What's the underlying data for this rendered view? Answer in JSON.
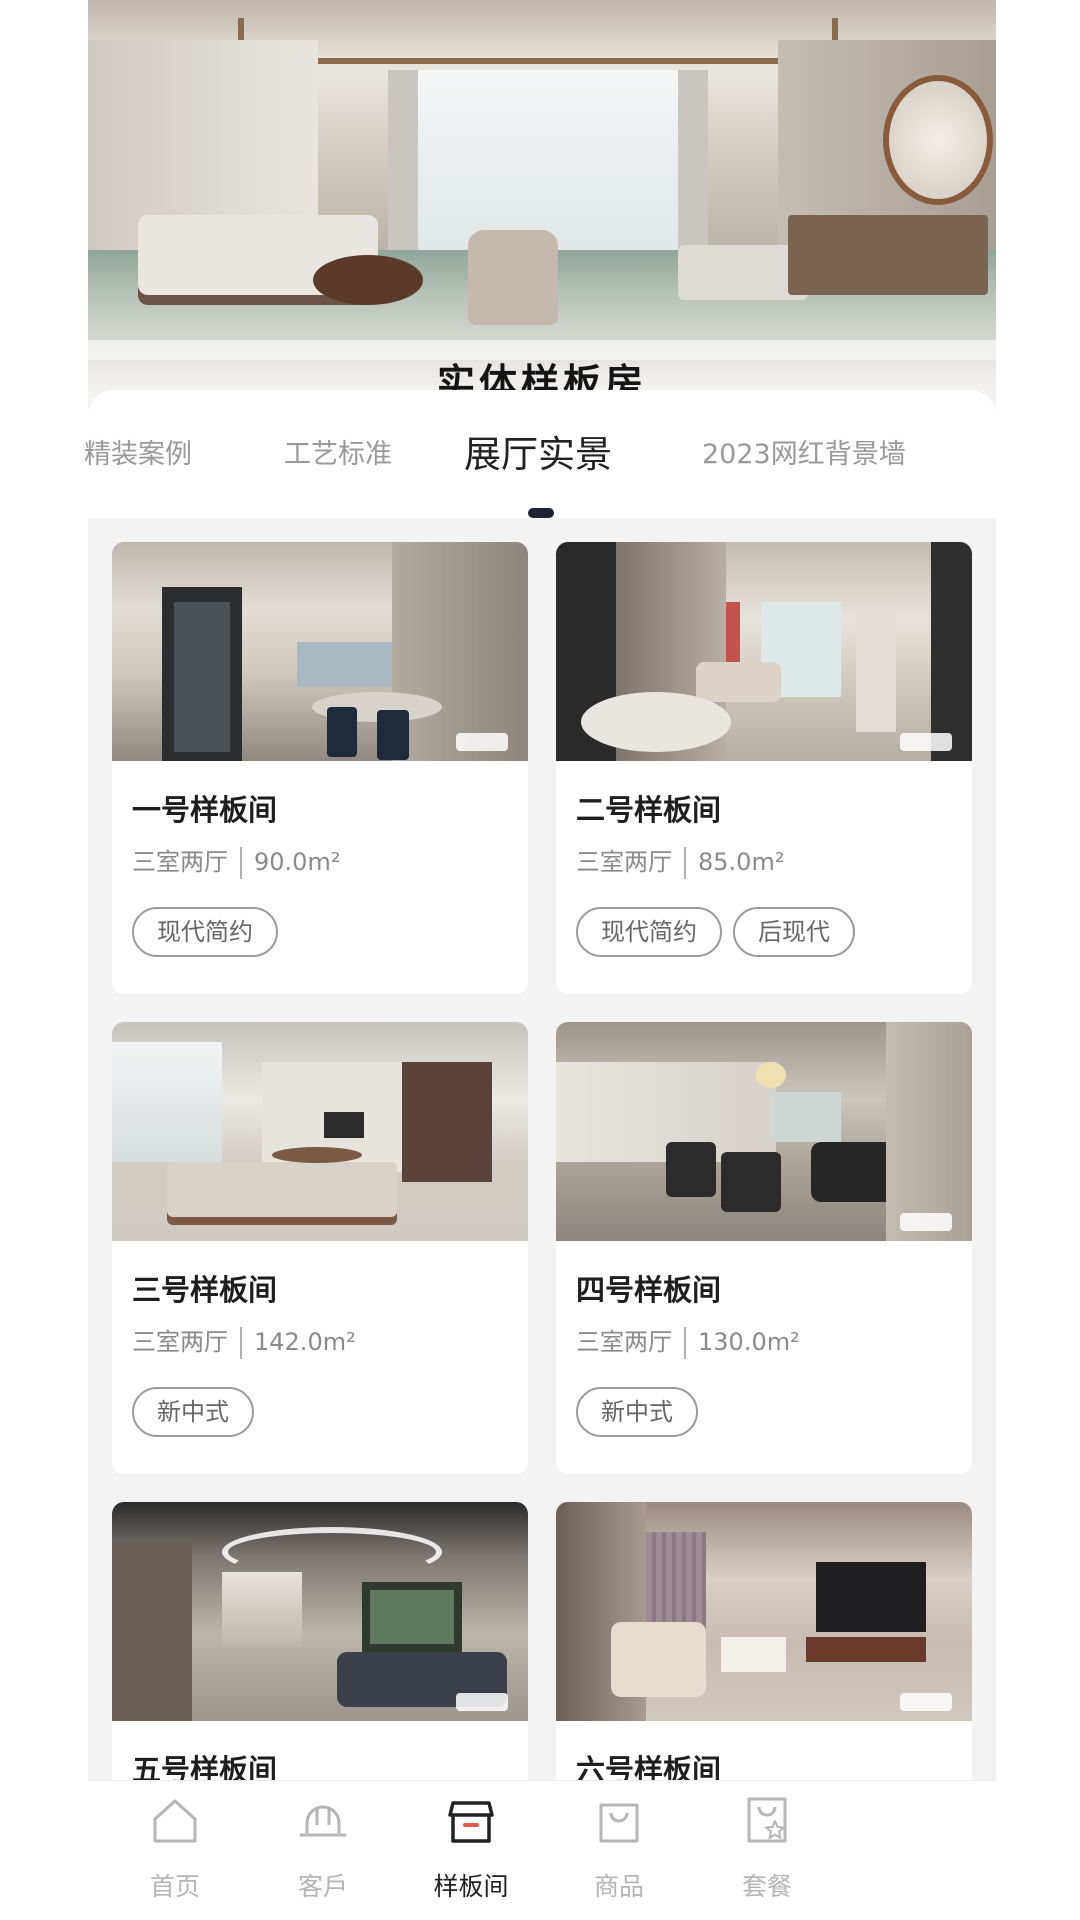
{
  "banner": {
    "caption": "实体样板房"
  },
  "tabs": [
    {
      "label": "精装案例",
      "active": false
    },
    {
      "label": "工艺标准",
      "active": false
    },
    {
      "label": "展厅实景",
      "active": true
    },
    {
      "label": "2023网红背景墙",
      "active": false
    }
  ],
  "cards": [
    {
      "name": "一号样板间",
      "layout": "三室两厅",
      "area": "90.0m²",
      "tags": [
        "现代简约"
      ]
    },
    {
      "name": "二号样板间",
      "layout": "三室两厅",
      "area": "85.0m²",
      "tags": [
        "现代简约",
        "后现代"
      ]
    },
    {
      "name": "三号样板间",
      "layout": "三室两厅",
      "area": "142.0m²",
      "tags": [
        "新中式"
      ]
    },
    {
      "name": "四号样板间",
      "layout": "三室两厅",
      "area": "130.0m²",
      "tags": [
        "新中式"
      ]
    },
    {
      "name": "五号样板间"
    },
    {
      "name": "六号样板间"
    }
  ],
  "bottom_nav": [
    {
      "label": "首页",
      "icon": "home-icon",
      "active": false
    },
    {
      "label": "客戶",
      "icon": "helmet-icon",
      "active": false
    },
    {
      "label": "样板间",
      "icon": "store-icon",
      "active": true
    },
    {
      "label": "商品",
      "icon": "shopping-bag-icon",
      "active": false
    },
    {
      "label": "套餐",
      "icon": "package-star-icon",
      "active": false
    }
  ],
  "colors": {
    "active_text": "#222222",
    "inactive_text": "#b5b5b5",
    "indicator": "#1d2133",
    "accent_red": "#e25a4a"
  }
}
